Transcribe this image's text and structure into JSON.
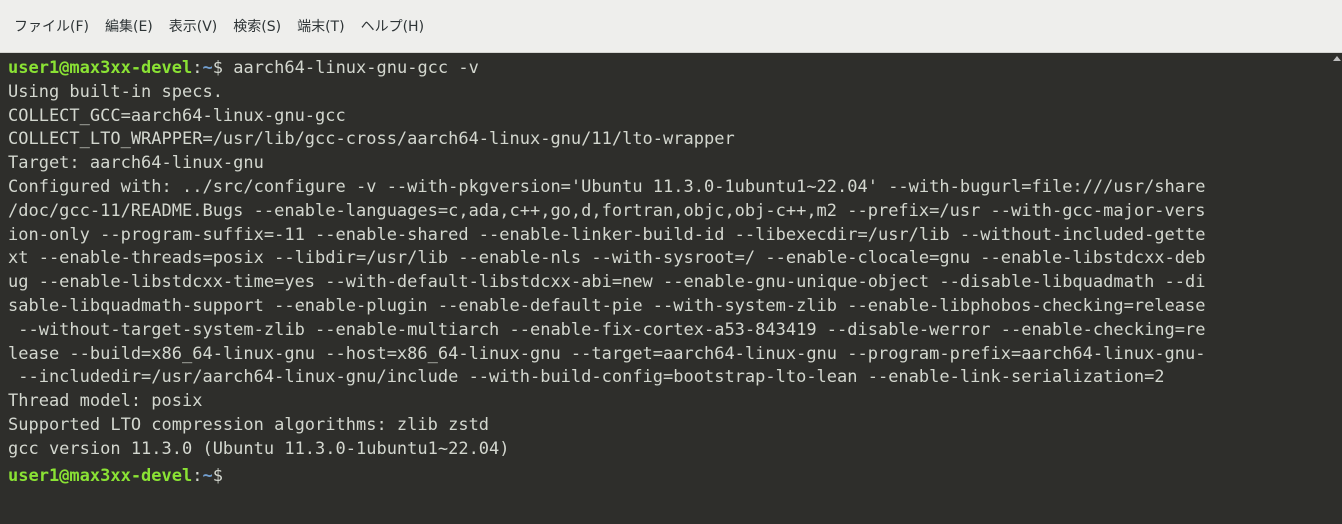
{
  "menu": [
    "ファイル(F)",
    "編集(E)",
    "表示(V)",
    "検索(S)",
    "端末(T)",
    "ヘルプ(H)"
  ],
  "prompt": {
    "user_host": "user1@max3xx-devel",
    "sep": ":",
    "path": "~",
    "symbol": "$"
  },
  "command": " aarch64-linux-gnu-gcc -v",
  "output": [
    "Using built-in specs.",
    "COLLECT_GCC=aarch64-linux-gnu-gcc",
    "COLLECT_LTO_WRAPPER=/usr/lib/gcc-cross/aarch64-linux-gnu/11/lto-wrapper",
    "Target: aarch64-linux-gnu",
    "Configured with: ../src/configure -v --with-pkgversion='Ubuntu 11.3.0-1ubuntu1~22.04' --with-bugurl=file:///usr/share",
    "/doc/gcc-11/README.Bugs --enable-languages=c,ada,c++,go,d,fortran,objc,obj-c++,m2 --prefix=/usr --with-gcc-major-vers",
    "ion-only --program-suffix=-11 --enable-shared --enable-linker-build-id --libexecdir=/usr/lib --without-included-gette",
    "xt --enable-threads=posix --libdir=/usr/lib --enable-nls --with-sysroot=/ --enable-clocale=gnu --enable-libstdcxx-deb",
    "ug --enable-libstdcxx-time=yes --with-default-libstdcxx-abi=new --enable-gnu-unique-object --disable-libquadmath --di",
    "sable-libquadmath-support --enable-plugin --enable-default-pie --with-system-zlib --enable-libphobos-checking=release",
    " --without-target-system-zlib --enable-multiarch --enable-fix-cortex-a53-843419 --disable-werror --enable-checking=re",
    "lease --build=x86_64-linux-gnu --host=x86_64-linux-gnu --target=aarch64-linux-gnu --program-prefix=aarch64-linux-gnu-",
    " --includedir=/usr/aarch64-linux-gnu/include --with-build-config=bootstrap-lto-lean --enable-link-serialization=2",
    "Thread model: posix",
    "Supported LTO compression algorithms: zlib zstd",
    "gcc version 11.3.0 (Ubuntu 11.3.0-1ubuntu1~22.04)"
  ],
  "colors": {
    "background": "#2e2e2b",
    "text": "#d3d7cf",
    "prompt_user": "#8ae234",
    "prompt_path": "#729fcf",
    "menubar": "#eeeeec"
  }
}
